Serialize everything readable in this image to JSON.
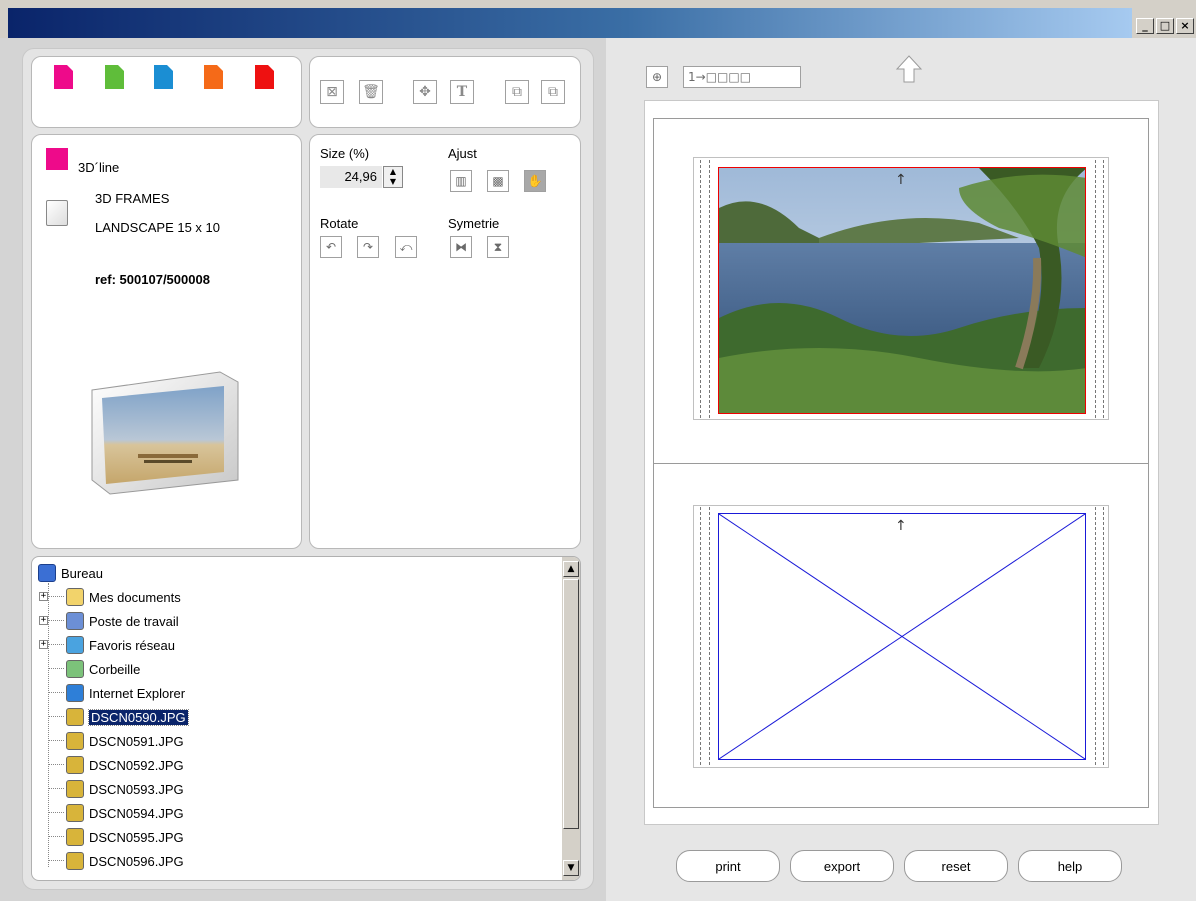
{
  "window": {
    "controls": [
      "_",
      "□",
      "×"
    ]
  },
  "palette": {
    "colors": [
      "#ee0a8a",
      "#5fbd3a",
      "#1b8ed3",
      "#f56a18",
      "#ee1111"
    ]
  },
  "product": {
    "line_name": "3D´line",
    "frame_name_line1": "3D FRAMES",
    "frame_name_line2": "LANDSCAPE 15 x 10",
    "ref": "ref: 500107/500008"
  },
  "controls": {
    "size_label": "Size (%)",
    "size_value": "24,96",
    "ajust_label": "Ajust",
    "rotate_label": "Rotate",
    "symetrie_label": "Symetrie"
  },
  "tree": {
    "root": "Bureau",
    "items": [
      {
        "label": "Mes documents",
        "expandable": true,
        "icon": "folder-icon"
      },
      {
        "label": "Poste de travail",
        "expandable": true,
        "icon": "computer-icon"
      },
      {
        "label": "Favoris réseau",
        "expandable": true,
        "icon": "network-icon"
      },
      {
        "label": "Corbeille",
        "expandable": false,
        "icon": "recycle-bin-icon"
      },
      {
        "label": "Internet Explorer",
        "expandable": false,
        "icon": "ie-icon"
      },
      {
        "label": "DSCN0590.JPG",
        "expandable": false,
        "icon": "jpg-file-icon",
        "selected": true
      },
      {
        "label": "DSCN0591.JPG",
        "expandable": false,
        "icon": "jpg-file-icon"
      },
      {
        "label": "DSCN0592.JPG",
        "expandable": false,
        "icon": "jpg-file-icon"
      },
      {
        "label": "DSCN0593.JPG",
        "expandable": false,
        "icon": "jpg-file-icon"
      },
      {
        "label": "DSCN0594.JPG",
        "expandable": false,
        "icon": "jpg-file-icon"
      },
      {
        "label": "DSCN0595.JPG",
        "expandable": false,
        "icon": "jpg-file-icon"
      },
      {
        "label": "DSCN0596.JPG",
        "expandable": false,
        "icon": "jpg-file-icon"
      }
    ]
  },
  "preview": {
    "nav_label": "1→□□□□",
    "arrow": "↑"
  },
  "buttons": {
    "print": "print",
    "export": "export",
    "reset": "reset",
    "help": "help"
  }
}
